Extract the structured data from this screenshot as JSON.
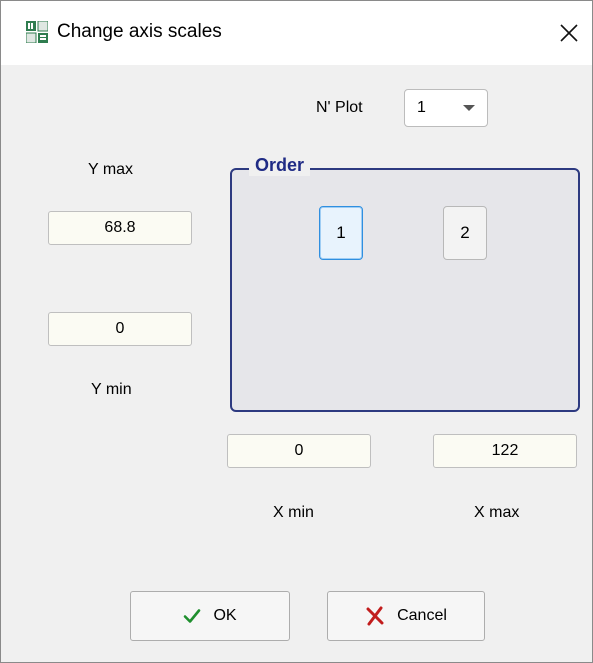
{
  "window": {
    "title": "Change axis scales",
    "icon": "app-grid-icon",
    "close_icon": "close-icon"
  },
  "plot": {
    "label": "N' Plot",
    "selected": "1"
  },
  "y_axis": {
    "max_label": "Y max",
    "max_value": "68.8",
    "min_label": "Y min",
    "min_value": "0"
  },
  "order": {
    "legend": "Order",
    "buttons": [
      "1",
      "2"
    ],
    "active": "1",
    "border_color": "#2d3a80"
  },
  "x_axis": {
    "min_label": "X min",
    "min_value": "0",
    "max_label": "X max",
    "max_value": "122"
  },
  "buttons": {
    "ok_label": "OK",
    "ok_icon": "check-icon",
    "cancel_label": "Cancel",
    "cancel_icon": "x-mark-icon"
  }
}
